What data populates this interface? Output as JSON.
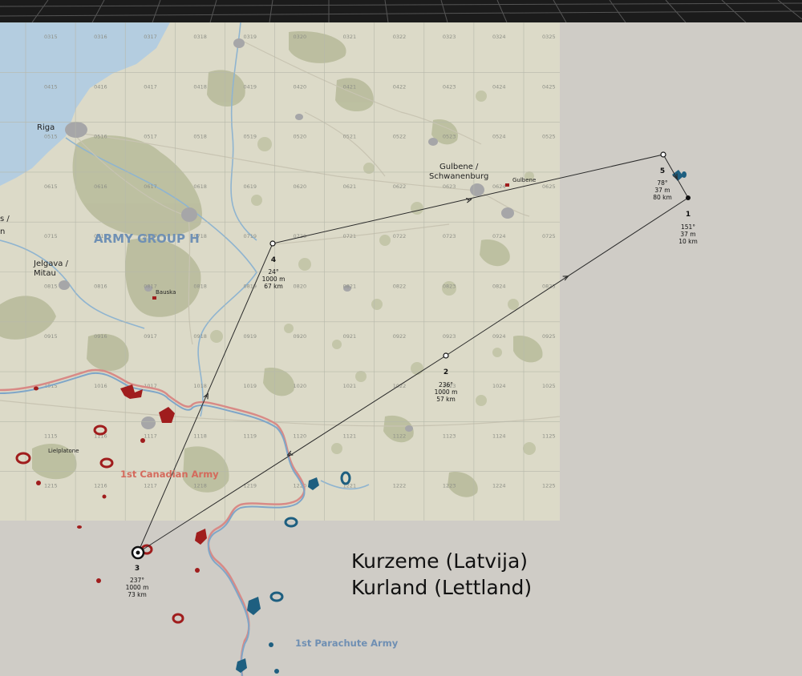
{
  "title": {
    "line1": "Kurzeme (Latvija)",
    "line2": "Kurland (Lettland)"
  },
  "cities": [
    {
      "name": "Riga",
      "label": "Riga"
    },
    {
      "name": "gulbene-1",
      "label": "Gulbene /"
    },
    {
      "name": "gulbene-2",
      "label": "Schwanenburg"
    },
    {
      "name": "jelgava-1",
      "label": "Jelgava /"
    },
    {
      "name": "jelgava-2",
      "label": "Mitau"
    },
    {
      "name": "edge-1",
      "label": "s /"
    },
    {
      "name": "edge-2",
      "label": "n"
    }
  ],
  "small_towns": [
    {
      "name": "gulbene-small",
      "label": "Gulbene"
    },
    {
      "name": "bauska",
      "label": "Bauska"
    },
    {
      "name": "lielplatone",
      "label": "Lielplatone"
    }
  ],
  "armies": {
    "army_group": "ARMY GROUP H",
    "red": "1st Canadian Army",
    "blue": "1st Parachute Army"
  },
  "grid_rows": [
    "03",
    "04",
    "05",
    "06",
    "07",
    "08",
    "09",
    "10",
    "11",
    "12"
  ],
  "grid_cols": [
    "15",
    "16",
    "17",
    "18",
    "19",
    "20",
    "21",
    "22",
    "23",
    "24",
    "25"
  ],
  "waypoints": [
    {
      "num": "1",
      "heading": "151°",
      "alt": "37 m",
      "dist": "10 km"
    },
    {
      "num": "2",
      "heading": "236°",
      "alt": "1000 m",
      "dist": "57 km"
    },
    {
      "num": "3",
      "heading": "237°",
      "alt": "1000 m",
      "dist": "73 km"
    },
    {
      "num": "4",
      "heading": "24°",
      "alt": "1000 m",
      "dist": "67 km"
    },
    {
      "num": "5",
      "heading": "78°",
      "alt": "37 m",
      "dist": "80 km"
    }
  ],
  "colors": {
    "map_land": "#dcdac8",
    "map_water": "#b4cde0",
    "forest": "#b9bc9c",
    "grid": "#b6b8aa",
    "outside": "#cfccc6",
    "route": "#2a2a2a",
    "front_red": "#d88a86",
    "front_blue": "#7fa6c8",
    "red_unit": "#a01d1d",
    "blue_unit": "#1e5f80"
  }
}
